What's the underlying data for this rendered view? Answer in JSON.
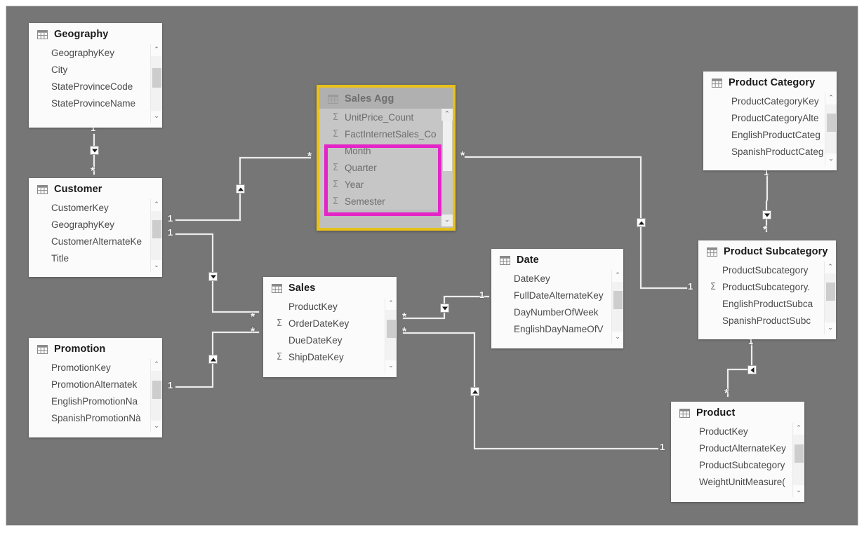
{
  "diagram": {
    "title": "Power BI Model View",
    "canvas_background": "#767676",
    "highlight_border_color": "#e524c8",
    "selected_border_color": "#e8c11c"
  },
  "icons": {
    "table": "table-grid-icon",
    "measure": "sigma-icon",
    "scroll_up": "chevron-up-icon",
    "scroll_down": "chevron-down-icon"
  },
  "symbols": {
    "sigma": "Σ",
    "chevron_up": "⌃",
    "chevron_down": "⌄",
    "one": "1",
    "many": "*"
  },
  "tables": [
    {
      "id": "geography",
      "name": "Geography",
      "selected": false,
      "fields": [
        {
          "name": "GeographyKey",
          "measure": false
        },
        {
          "name": "City",
          "measure": false
        },
        {
          "name": "StateProvinceCode",
          "measure": false
        },
        {
          "name": "StateProvinceName",
          "measure": false
        }
      ]
    },
    {
      "id": "customer",
      "name": "Customer",
      "selected": false,
      "fields": [
        {
          "name": "CustomerKey",
          "measure": false
        },
        {
          "name": "GeographyKey",
          "measure": false
        },
        {
          "name": "CustomerAlternateKe",
          "measure": false
        },
        {
          "name": "Title",
          "measure": false
        }
      ]
    },
    {
      "id": "promotion",
      "name": "Promotion",
      "selected": false,
      "fields": [
        {
          "name": "PromotionKey",
          "measure": false
        },
        {
          "name": "PromotionAlternatek",
          "measure": false
        },
        {
          "name": "EnglishPromotionNa",
          "measure": false
        },
        {
          "name": "SpanishPromotionNà",
          "measure": false
        }
      ]
    },
    {
      "id": "salesagg",
      "name": "Sales Agg",
      "selected": true,
      "fields": [
        {
          "name": "UnitPrice_Count",
          "measure": true
        },
        {
          "name": "FactInternetSales_Co",
          "measure": true
        },
        {
          "name": "Month",
          "measure": false
        },
        {
          "name": "Quarter",
          "measure": true
        },
        {
          "name": "Year",
          "measure": true
        },
        {
          "name": "Semester",
          "measure": true
        }
      ],
      "highlighted_fields": [
        "Month",
        "Quarter",
        "Year",
        "Semester"
      ]
    },
    {
      "id": "sales",
      "name": "Sales",
      "selected": false,
      "fields": [
        {
          "name": "ProductKey",
          "measure": false
        },
        {
          "name": "OrderDateKey",
          "measure": true
        },
        {
          "name": "DueDateKey",
          "measure": false
        },
        {
          "name": "ShipDateKey",
          "measure": true
        }
      ]
    },
    {
      "id": "date",
      "name": "Date",
      "selected": false,
      "fields": [
        {
          "name": "DateKey",
          "measure": false
        },
        {
          "name": "FullDateAlternateKey",
          "measure": false
        },
        {
          "name": "DayNumberOfWeek",
          "measure": false
        },
        {
          "name": "EnglishDayNameOfV",
          "measure": false
        }
      ]
    },
    {
      "id": "productcategory",
      "name": "Product Category",
      "selected": false,
      "fields": [
        {
          "name": "ProductCategoryKey",
          "measure": false
        },
        {
          "name": "ProductCategoryAlte",
          "measure": false
        },
        {
          "name": "EnglishProductCateg",
          "measure": false
        },
        {
          "name": "SpanishProductCateɡ",
          "measure": false
        }
      ]
    },
    {
      "id": "productsubcategory",
      "name": "Product Subcategory",
      "selected": false,
      "fields": [
        {
          "name": "ProductSubcategory",
          "measure": false
        },
        {
          "name": "ProductSubcategory.",
          "measure": true
        },
        {
          "name": "EnglishProductSubca",
          "measure": false
        },
        {
          "name": "SpanishProductSubc",
          "measure": false
        }
      ]
    },
    {
      "id": "product",
      "name": "Product",
      "selected": false,
      "fields": [
        {
          "name": "ProductKey",
          "measure": false
        },
        {
          "name": "ProductAlternateKey",
          "measure": false
        },
        {
          "name": "ProductSubcategory",
          "measure": false
        },
        {
          "name": "WeightUnitMeasure(",
          "measure": false
        }
      ]
    }
  ],
  "relationships": [
    {
      "id": "geography-customer",
      "from": "Geography",
      "to": "Customer",
      "from_card": "1",
      "to_card": "*",
      "direction": "down"
    },
    {
      "id": "customer-salesagg",
      "from": "Customer",
      "to": "Sales Agg",
      "from_card": "1",
      "to_card": "*",
      "direction": "up"
    },
    {
      "id": "customer-sales",
      "from": "Customer",
      "to": "Sales",
      "from_card": "1",
      "to_card": "*",
      "direction": "down"
    },
    {
      "id": "promotion-sales",
      "from": "Promotion",
      "to": "Sales",
      "from_card": "1",
      "to_card": "*",
      "direction": "up"
    },
    {
      "id": "salesagg-productsubcategory",
      "from": "Sales Agg",
      "to": "Product Subcategory",
      "from_card": "*",
      "to_card": "1",
      "direction": "up"
    },
    {
      "id": "sales-date",
      "from": "Sales",
      "to": "Date",
      "from_card": "*",
      "to_card": "1",
      "direction": "down"
    },
    {
      "id": "sales-product",
      "from": "Sales",
      "to": "Product",
      "from_card": "*",
      "to_card": "1",
      "direction": "up"
    },
    {
      "id": "productcategory-productsubcategory",
      "from": "Product Category",
      "to": "Product Subcategory",
      "from_card": "1",
      "to_card": "*",
      "direction": "down"
    },
    {
      "id": "productsubcategory-product",
      "from": "Product Subcategory",
      "to": "Product",
      "from_card": "1",
      "to_card": "*",
      "direction": "left"
    }
  ]
}
